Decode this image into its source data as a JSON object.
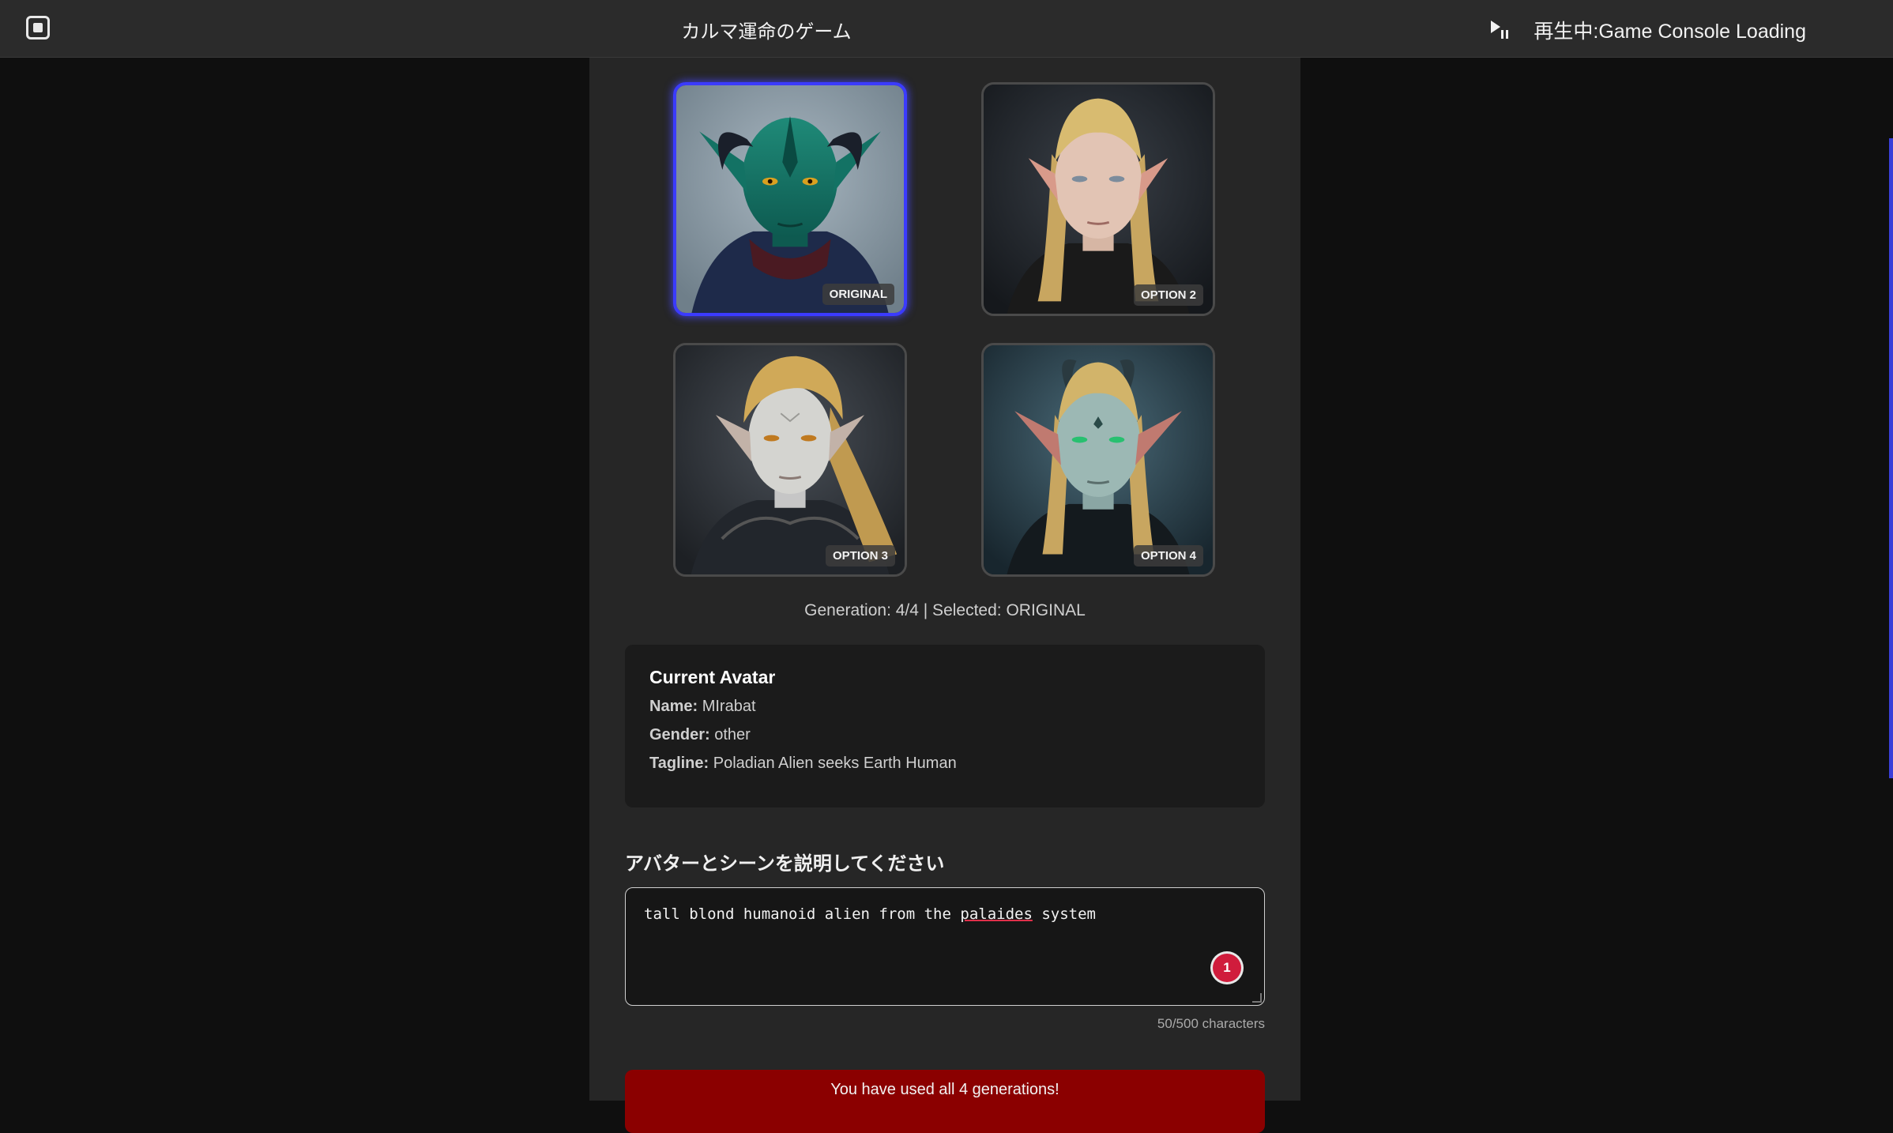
{
  "header": {
    "title": "カルマ運命のゲーム",
    "now_playing": "再生中:Game Console Loading"
  },
  "avatars": [
    {
      "label": "ORIGINAL",
      "selected": true
    },
    {
      "label": "OPTION 2",
      "selected": false
    },
    {
      "label": "OPTION 3",
      "selected": false
    },
    {
      "label": "OPTION 4",
      "selected": false
    }
  ],
  "generation_status": "Generation: 4/4 | Selected: ORIGINAL",
  "current_avatar": {
    "heading": "Current Avatar",
    "name_label": "Name:",
    "name": "MIrabat",
    "gender_label": "Gender:",
    "gender": "other",
    "tagline_label": "Tagline:",
    "tagline": "Poladian Alien seeks Earth Human"
  },
  "prompt": {
    "label": "アバターとシーンを説明してください",
    "text_before": "tall blond humanoid alien from the ",
    "misspelled_word": "palaides",
    "text_after": " system",
    "issue_count": "1",
    "char_count": "50/500 characters"
  },
  "limit_message": "You have used all 4 generations!",
  "colors": {
    "accent_selected": "#3b3bff",
    "banner": "#8b0000",
    "badge": "#d01c3c"
  }
}
